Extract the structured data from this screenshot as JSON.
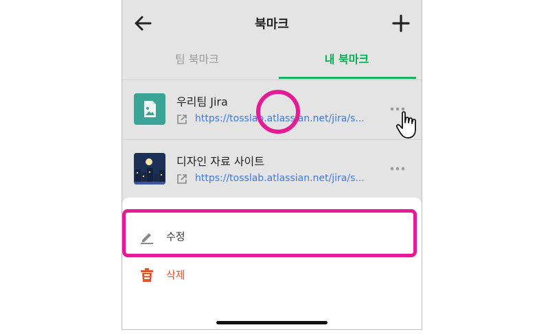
{
  "header": {
    "title": "북마크",
    "back_icon": "arrow-left-icon",
    "add_icon": "plus-icon"
  },
  "tabs": [
    {
      "label": "팀 북마크",
      "active": false
    },
    {
      "label": "내 북마크",
      "active": true
    }
  ],
  "bookmarks": [
    {
      "title": "우리팀 Jira",
      "url": "https://tosslab.atlassian.net/jira/s...",
      "thumbnail": "image-placeholder-icon"
    },
    {
      "title": "디자인 자료 사이트",
      "url": "https://tosslab.atlassian.net/jira/s...",
      "thumbnail": "night-city-thumbnail"
    }
  ],
  "action_sheet": {
    "edit_label": "수정",
    "delete_label": "삭제"
  },
  "colors": {
    "accent": "#14b45a",
    "link": "#3a7bdc",
    "danger": "#e0542c",
    "highlight": "#e51a94"
  }
}
